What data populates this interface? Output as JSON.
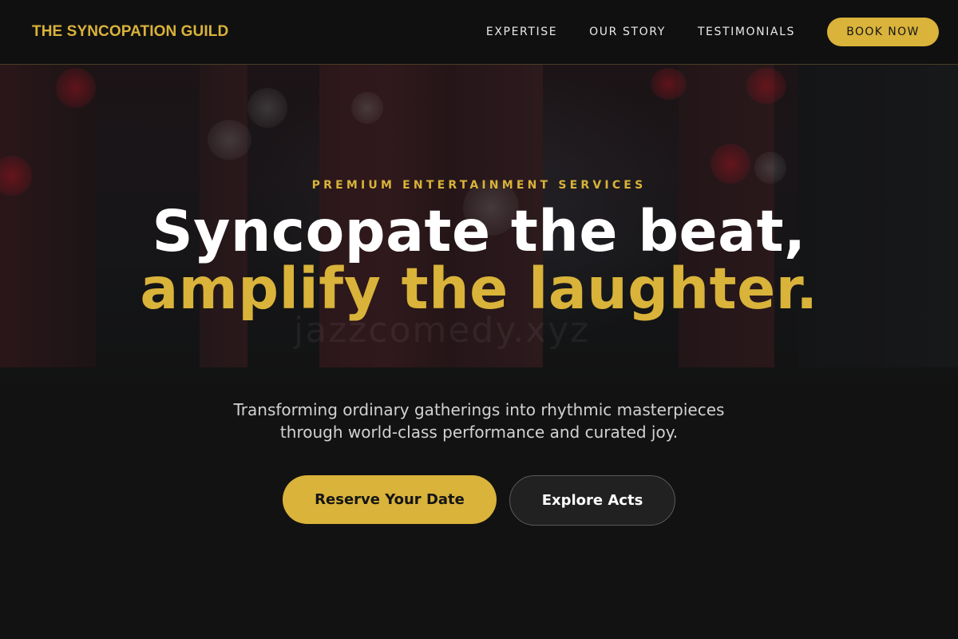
{
  "header": {
    "brand": "THE SYNCOPATION GUILD",
    "nav": [
      "EXPERTISE",
      "OUR STORY",
      "TESTIMONIALS"
    ],
    "cta_label": "BOOK NOW"
  },
  "hero": {
    "eyebrow": "PREMIUM ENTERTAINMENT SERVICES",
    "headline_line1": "Syncopate the beat,",
    "headline_accent": "amplify the laughter.",
    "subtitle": "Transforming ordinary gatherings into rhythmic masterpieces through world-class performance and curated joy.",
    "primary_button": "Reserve Your Date",
    "secondary_button": "Explore Acts",
    "background_watermark": "jazzcomedy.xyz"
  },
  "colors": {
    "accent": "#d9b33a",
    "background": "#121212",
    "text": "#ffffff"
  }
}
